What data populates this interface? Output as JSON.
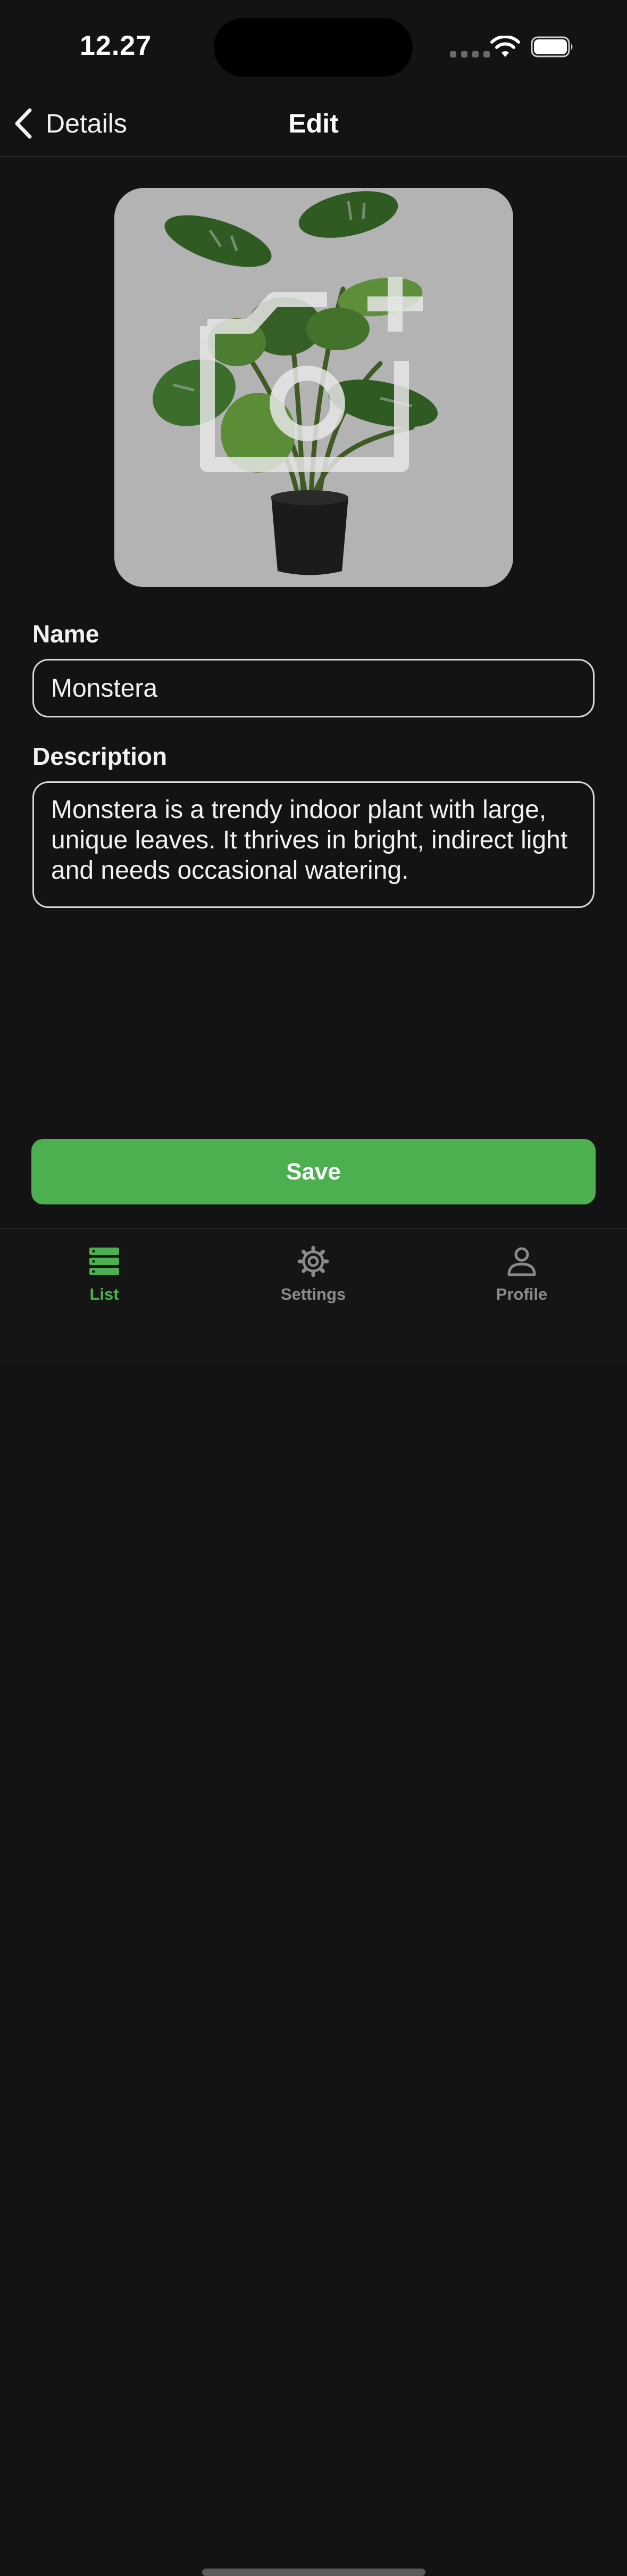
{
  "status_bar": {
    "time": "12.27",
    "icons": [
      "cellular-signal-icon",
      "wifi-icon",
      "battery-icon"
    ]
  },
  "nav": {
    "back_label": "Details",
    "title": "Edit",
    "back_icon": "chevron-left-icon"
  },
  "image_picker": {
    "image": "monstera-plant-in-black-pot",
    "overlay_icon": "camera-add-icon"
  },
  "form": {
    "name_label": "Name",
    "name_value": "Monstera",
    "description_label": "Description",
    "description_value": "Monstera is a trendy indoor plant with large, unique leaves. It thrives in bright, indirect light and needs occasional watering."
  },
  "save_label": "Save",
  "tabs": [
    {
      "label": "List",
      "icon": "list-icon",
      "active": true
    },
    {
      "label": "Settings",
      "icon": "gear-icon",
      "active": false
    },
    {
      "label": "Profile",
      "icon": "person-icon",
      "active": false
    }
  ],
  "colors": {
    "background": "#131313",
    "accent": "#4caf50",
    "inactive_tab": "#8a8a8a",
    "image_bg": "#b3b3b3"
  }
}
